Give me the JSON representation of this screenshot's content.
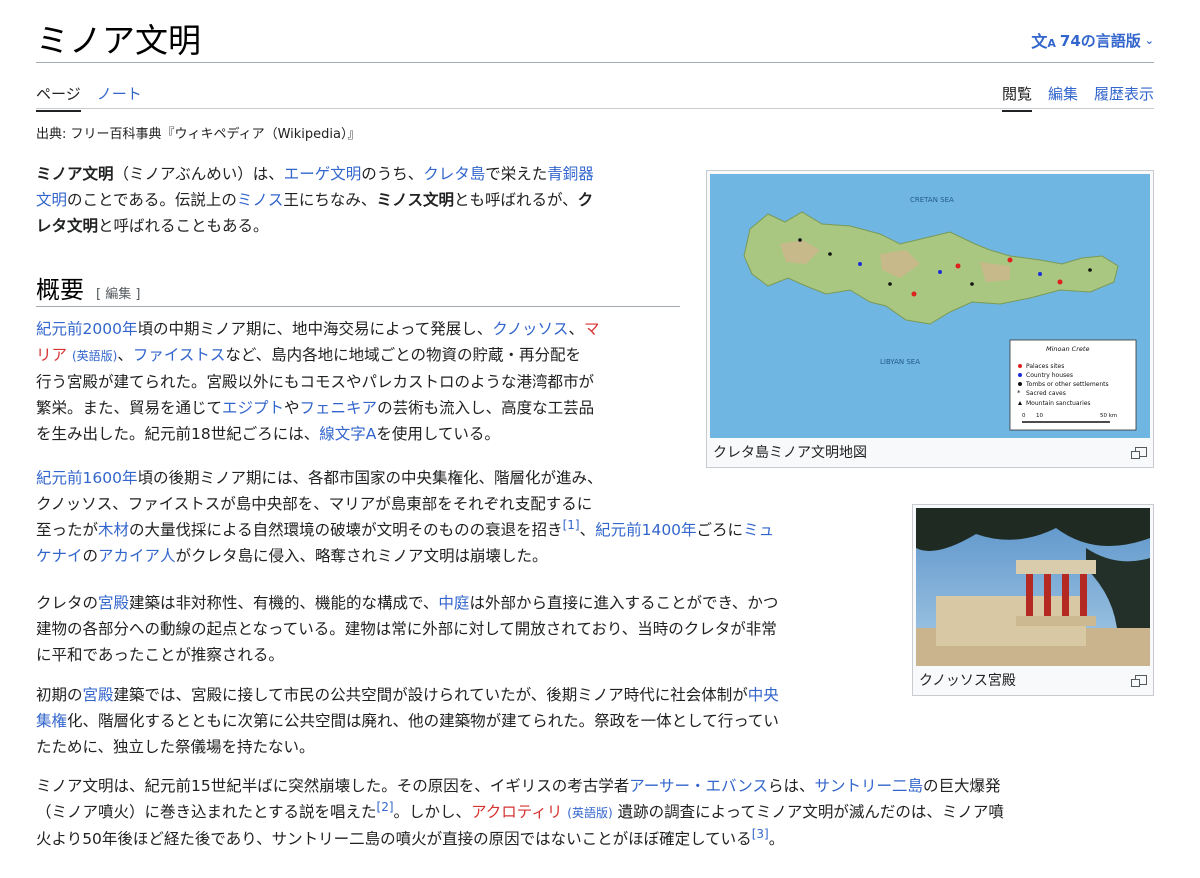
{
  "page": {
    "title": "ミノア文明",
    "languages_label": "74の言語版",
    "tabs_left": [
      "ページ",
      "ノート"
    ],
    "tabs_right": [
      "閲覧",
      "編集",
      "履歴表示"
    ],
    "source": "出典: フリー百科事典『ウィキペディア（Wikipedia）』"
  },
  "section": {
    "heading": "概要",
    "edit_label": "[ 編集 ]"
  },
  "figures": {
    "map_caption": "クレタ島ミノア文明地図",
    "map_sea_top": "CRETAN SEA",
    "map_sea_bottom": "LIBYAN SEA",
    "map_legend_title": "Minoan Crete",
    "map_legend": [
      "Palaces sites",
      "Country houses",
      "Tombs or other settlements",
      "Sacred caves",
      "Mountain sanctuaries"
    ],
    "map_scale_labels": [
      "0",
      "10",
      "50 km"
    ],
    "photo_caption": "クノッソス宮殿"
  },
  "colors": {
    "link": "#3366cc",
    "redlink": "#d73333",
    "sea": "#6fb6e3"
  }
}
